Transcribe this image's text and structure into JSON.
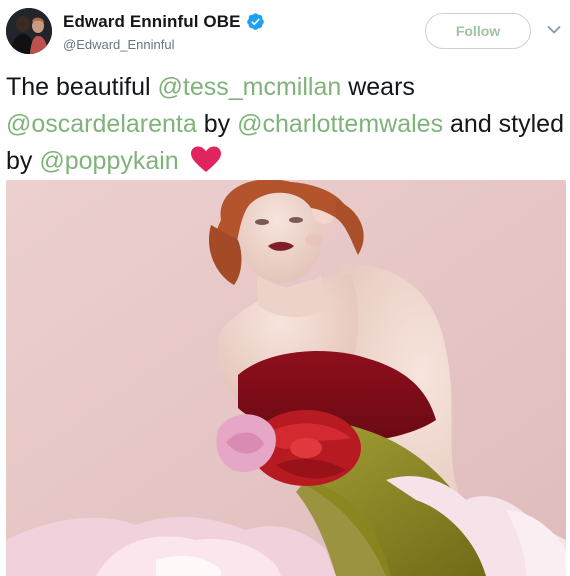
{
  "tweet": {
    "author": {
      "display_name": "Edward Enninful OBE",
      "handle": "@Edward_Enninful",
      "verified": true
    },
    "follow_label": "Follow",
    "text": {
      "part1": "The beautiful ",
      "mention1": "@tess_mcmillan",
      "part2": " wears ",
      "mention2": "@oscardelarenta",
      "part3": " by ",
      "mention3": "@charlottemwales",
      "part4": " and styled by ",
      "mention4": "@poppykain"
    },
    "emoji": "heart-icon",
    "colors": {
      "mention": "#7fb37a",
      "follow_text": "#9fc3a4",
      "verified": "#1da1f2",
      "heart": "#e0245e",
      "photo_background": "#e7c9c8"
    }
  }
}
